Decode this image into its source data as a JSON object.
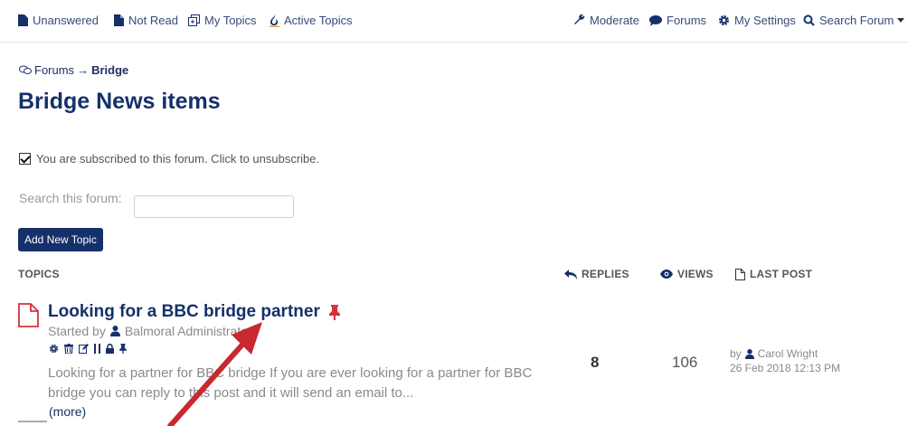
{
  "nav": {
    "unanswered": "Unanswered",
    "not_read": "Not Read",
    "my_topics": "My Topics",
    "active_topics": "Active Topics",
    "moderate": "Moderate",
    "forums": "Forums",
    "my_settings": "My Settings",
    "search_forum": "Search Forum"
  },
  "breadcrumb": {
    "root": "Forums",
    "separator": "→",
    "current": "Bridge"
  },
  "page": {
    "title": "Bridge News items",
    "subscribe_text": "You are subscribed to this forum. Click to unsubscribe.",
    "search_label": "Search this forum:",
    "search_value": "",
    "add_topic_label": "Add New Topic"
  },
  "columns": {
    "topics": "TOPICS",
    "replies": "REPLIES",
    "views": "VIEWS",
    "last_post": "LAST POST"
  },
  "topic": {
    "title": "Looking for a BBC bridge partner",
    "started_prefix": "Started by",
    "author": "Balmoral Administrator",
    "excerpt": "Looking for a partner for BBC bridge If you are ever  looking for a partner for BBC bridge you can reply to this post and it will send an email to...",
    "more": "(more)",
    "replies": "8",
    "views": "106",
    "last_post_by_prefix": "by",
    "last_post_user": "Carol Wright",
    "last_post_date": "26 Feb 2018 12:13 PM"
  },
  "colors": {
    "brand": "#15306b",
    "nav_text": "#3a4a7a",
    "pin": "#d9303a",
    "annotation_arrow": "#c8282e"
  },
  "icons": {
    "unanswered": "doc-solid-icon",
    "not_read": "doc-fold-icon",
    "my_topics": "copy-icon",
    "active_topics": "flame-icon",
    "moderate": "wrench-icon",
    "forums": "speech-bubble-icon",
    "my_settings": "gear-icon",
    "search_forum": "magnifier-icon",
    "replies": "reply-arrow-icon",
    "views": "eye-icon",
    "last_post": "doc-outline-icon",
    "topic": "doc-red-icon",
    "pin": "pushpin-icon"
  }
}
